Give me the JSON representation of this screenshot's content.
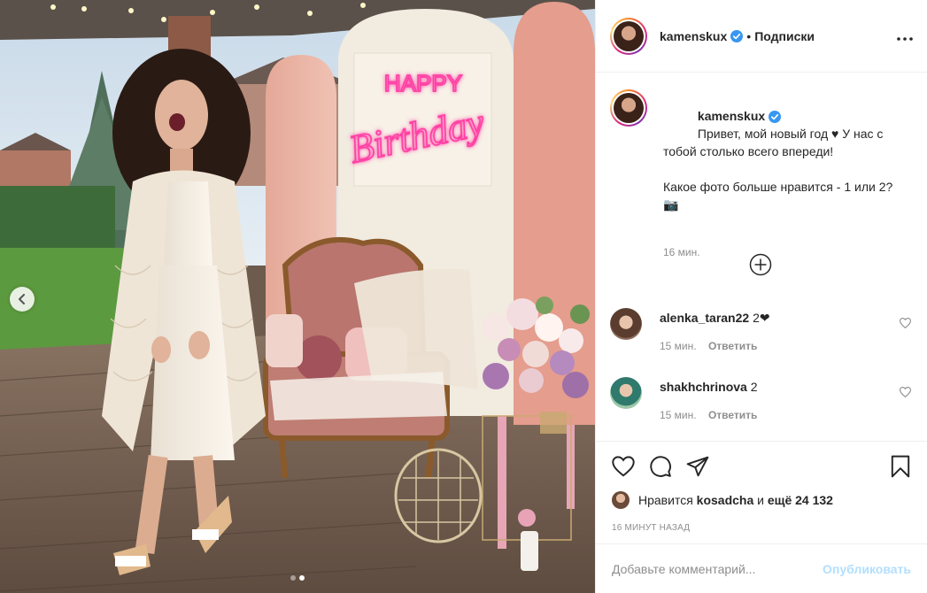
{
  "post": {
    "author": "kamenskux",
    "follow_status": "Подписки",
    "caption": "Привет, мой новый год ♥ У нас с тобой столько всего впереди!\n\nКакое фото больше нравится - 1 или 2?📷",
    "caption_time": "16 мин.",
    "photo_neon_line1": "HAPPY",
    "photo_neon_line2": "Birthday",
    "carousel": {
      "current": 2,
      "total": 2
    }
  },
  "comments": [
    {
      "user": "alenka_taran22",
      "text": "2❤",
      "time": "15 мин.",
      "reply_label": "Ответить"
    },
    {
      "user": "shakhchrinova",
      "text": "2",
      "time": "15 мин.",
      "reply_label": "Ответить"
    }
  ],
  "likes": {
    "prefix": "Нравится",
    "liked_by": "kosadcha",
    "connector": "и",
    "others": "ещё 24 132"
  },
  "posted_ago": "16 минут назад",
  "add_comment": {
    "placeholder": "Добавьте комментарий...",
    "publish_label": "Опубликовать"
  },
  "colors": {
    "verified": "#3897f0",
    "neon_pink": "#ff3fa4",
    "publish_disabled": "#b2dffc",
    "muted_text": "#8e8e8e"
  },
  "icons": [
    "chevron-left-icon",
    "verified-badge-icon",
    "more-icon",
    "add-circle-icon",
    "heart-icon",
    "comment-icon",
    "share-icon",
    "bookmark-icon"
  ]
}
